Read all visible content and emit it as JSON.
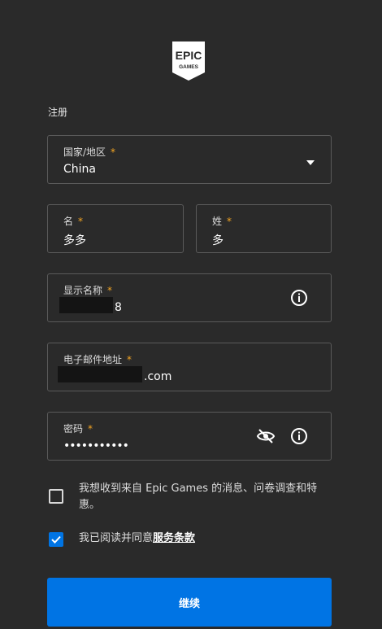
{
  "logo": {
    "line1": "EPIC",
    "line2": "GAMES"
  },
  "page_title": "注册",
  "country": {
    "label": "国家/地区",
    "value": "China"
  },
  "first_name": {
    "label": "名",
    "value": "多多"
  },
  "last_name": {
    "label": "姓",
    "value": "多"
  },
  "display_name": {
    "label": "显示名称",
    "value_tail": "8"
  },
  "email": {
    "label": "电子邮件地址",
    "value_tail": ".com"
  },
  "password": {
    "label": "密码",
    "value": "•••••••••••"
  },
  "required_mark": "*",
  "newsletter": {
    "label": "我想收到来自 Epic Games 的消息、问卷调查和特惠。",
    "checked": false
  },
  "terms": {
    "label_prefix": "我已阅读并同意",
    "link": "服务条款",
    "checked": true
  },
  "continue_button": "继续",
  "colors": {
    "accent": "#0074e4",
    "required": "#f5a623",
    "background": "#2a2a2a"
  }
}
